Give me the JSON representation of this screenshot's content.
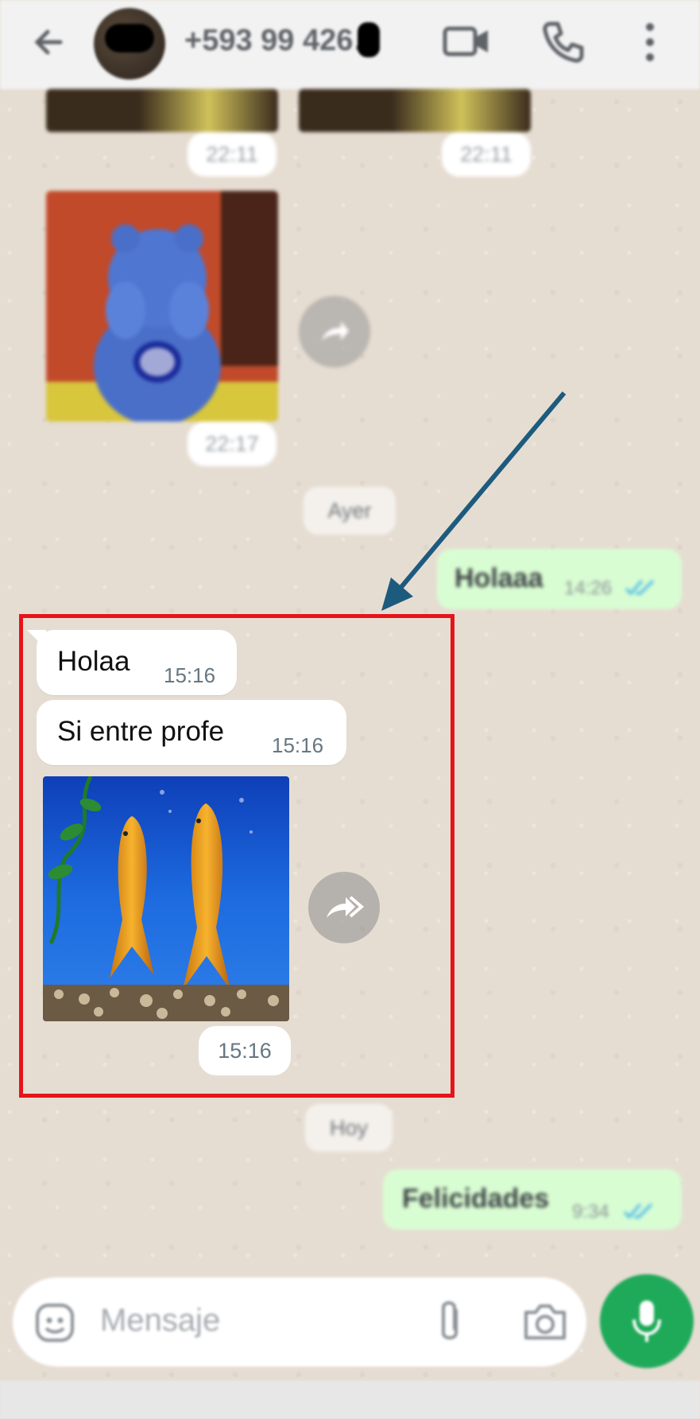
{
  "header": {
    "contact_name": "+593 99 426…",
    "icons": [
      "back-arrow-icon",
      "video-call-icon",
      "phone-icon",
      "more-vert-icon"
    ]
  },
  "older_messages": {
    "top_times": [
      "22:11",
      "22:11"
    ],
    "sticker_time": "22:17"
  },
  "dates": {
    "yesterday": "Ayer",
    "today": "Hoy"
  },
  "outgoing": [
    {
      "text": "Holaaa",
      "time": "14:26"
    },
    {
      "text": "Felicidades",
      "time": "9:34"
    }
  ],
  "highlighted": {
    "messages": [
      {
        "text": "Holaa",
        "time": "15:16"
      },
      {
        "text": "Si entre profe",
        "time": "15:16"
      }
    ],
    "image_time": "15:16"
  },
  "composer": {
    "placeholder": "Mensaje",
    "icons": [
      "emoji-icon",
      "attach-icon",
      "camera-icon",
      "mic-icon"
    ]
  },
  "colors": {
    "outgoing_bubble": "#d9fdd3",
    "highlight_border": "#e5141a",
    "annotation_arrow": "#1d5b7e",
    "mic_button": "#1faa59",
    "read_ticks": "#53bdeb"
  }
}
